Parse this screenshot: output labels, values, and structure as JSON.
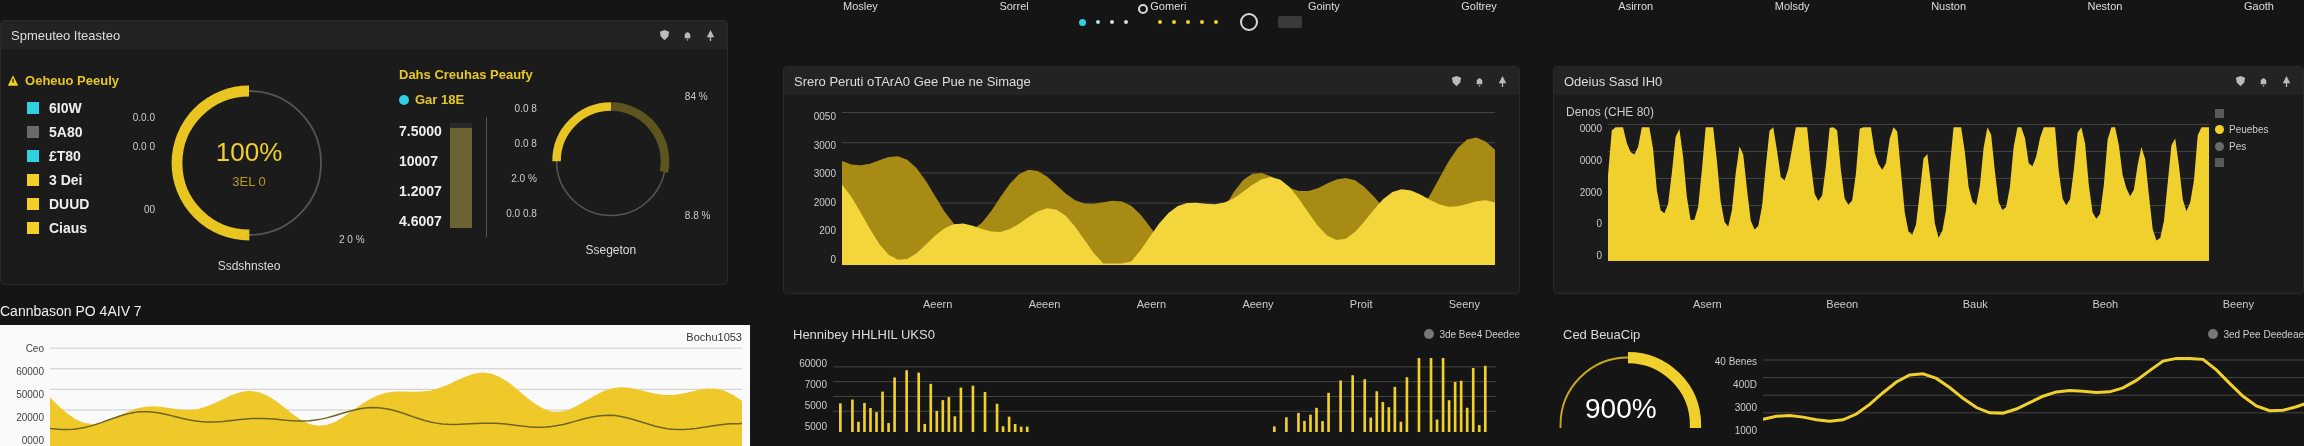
{
  "top_nav": [
    "Mosley",
    "Sorrel",
    "Gomeri",
    "Gointy",
    "Goltrey",
    "Asirron",
    "Molsdy",
    "Nuston",
    "Neston",
    "Gaoth"
  ],
  "pager": [
    {
      "kind": "dot",
      "color": "#2fd0e0",
      "selected": true
    },
    {
      "kind": "dot",
      "color": "#9fe6ee",
      "selected": false
    },
    {
      "kind": "dot",
      "color": "#d8d8d8",
      "selected": false
    },
    {
      "kind": "dot",
      "color": "#d8d8d8",
      "selected": false
    },
    {
      "kind": "ring",
      "color": "#d8d8d8",
      "selected": false
    },
    {
      "kind": "dot",
      "color": "#f2d027",
      "selected": false
    },
    {
      "kind": "dot",
      "color": "#f2d027",
      "selected": false
    },
    {
      "kind": "dot",
      "color": "#f2d027",
      "selected": false
    },
    {
      "kind": "dot",
      "color": "#f2d027",
      "selected": false
    },
    {
      "kind": "dot",
      "color": "#f2d027",
      "selected": false
    },
    {
      "kind": "big-ring",
      "color": "#d8d8d8",
      "selected": false
    },
    {
      "kind": "pill",
      "color": "#3a3a3a",
      "selected": false
    }
  ],
  "summary_panel": {
    "title": "Spmeuteo Iteasteo",
    "legend": {
      "title": "Oeheuo Peeuly",
      "items": [
        {
          "label": "6I0W",
          "color": "#2fd0e0"
        },
        {
          "label": "5A80",
          "color": "#6b6b6b"
        },
        {
          "label": "£T80",
          "color": "#2fd0e0"
        },
        {
          "label": "3 Dei",
          "color": "#f2d027"
        },
        {
          "label": "DUUD",
          "color": "#f2d027"
        },
        {
          "label": "Ciaus",
          "color": "#f2d027"
        }
      ]
    },
    "gauge": {
      "value": "100%",
      "subvalue": "3EL 0",
      "level": 0.5,
      "labels": [
        "0.0.0",
        "0.0 0",
        "00",
        "2 0 %"
      ],
      "caption": "Ssdshnsteo"
    },
    "breakdown": {
      "title": "Dahs Creuhas Peaufy",
      "badge": {
        "label": "Gar 18E",
        "color": "#2fd0e0"
      },
      "values": [
        "7.5000",
        "10007",
        "1.2007",
        "4.6007"
      ],
      "bar": {
        "level": 0.95
      },
      "ring": {
        "level": 0.25,
        "labels": [
          "84 %",
          "0.0 8",
          "0.0 8",
          "2.0 %",
          "0.0 0.8",
          "8.8 %"
        ],
        "caption": "Ssegeton"
      }
    }
  },
  "comparison": {
    "title": "Cannbason PO 4AIV 7",
    "chart_title": "Bochu1053",
    "y_ticks": [
      "Ceo",
      "60000",
      "50000",
      "20000",
      "0000"
    ]
  },
  "traffic": {
    "title": "Srero Peruti oTArA0 Gee Pue ne Simage",
    "y_ticks": [
      "0050",
      "3000",
      "3000",
      "2000",
      "200",
      "0"
    ],
    "x_labels": [
      "Aeern",
      "Aeeen",
      "Aeern",
      "Aeeny",
      "Proit",
      "Seeny"
    ]
  },
  "outliers": {
    "title": "Odeius Sasd IH0",
    "subtitle": "Denos (CHE 80)",
    "y_ticks": [
      "0000",
      "0000",
      "2000",
      "0",
      "0"
    ],
    "legend": [
      {
        "kind": "swatch",
        "color": "#5a5a5a"
      },
      {
        "kind": "entry",
        "label": "Peuebes",
        "color": "#f2d027"
      },
      {
        "kind": "entry",
        "label": "Pes",
        "color": "#6a6a6a"
      },
      {
        "kind": "swatch",
        "color": "#5a5a5a"
      }
    ],
    "x_labels": [
      "Asern",
      "Beeon",
      "Bauk",
      "Beoh",
      "Beeny"
    ]
  },
  "monthly": {
    "title": "Hennibey HHLHIL UKS0",
    "legend": "3de Bee4 Deedee",
    "y_ticks": [
      "60000",
      "7000",
      "5000",
      "5000"
    ]
  },
  "cost": {
    "title": "Ced BeuaCip",
    "legend": "3ed Pee Deedeae",
    "donut": {
      "value": "900%",
      "level": 0.3
    },
    "y_ticks": [
      "40 Benes",
      "400D",
      "3000",
      "1000"
    ]
  }
}
